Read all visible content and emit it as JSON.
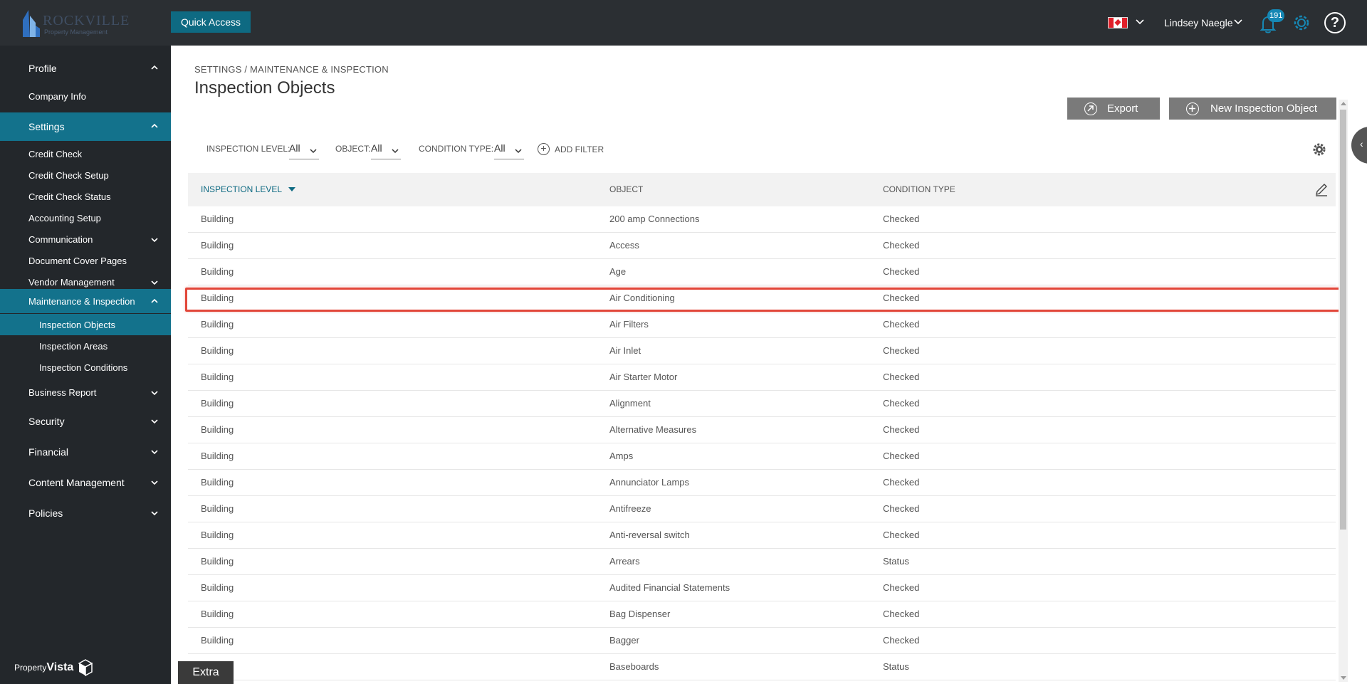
{
  "topbar": {
    "logo_text": "ROCKVILLE",
    "logo_subtitle": "Property Management",
    "quick_access": "Quick Access",
    "user_name": "Lindsey Naegle",
    "notification_count": "191",
    "help_icon": "?"
  },
  "sidebar": {
    "items": [
      {
        "label": "Profile"
      },
      {
        "label": "Company Info"
      },
      {
        "label": "Settings"
      },
      {
        "label": "Credit Check"
      },
      {
        "label": "Credit Check Setup"
      },
      {
        "label": "Credit Check Status"
      },
      {
        "label": "Accounting Setup"
      },
      {
        "label": "Communication"
      },
      {
        "label": "Document Cover Pages"
      },
      {
        "label": "Vendor Management"
      },
      {
        "label": "Maintenance & Inspection"
      },
      {
        "label": "Inspection Objects"
      },
      {
        "label": "Inspection Areas"
      },
      {
        "label": "Inspection Conditions"
      },
      {
        "label": "Business Report"
      },
      {
        "label": "Security"
      },
      {
        "label": "Financial"
      },
      {
        "label": "Content Management"
      },
      {
        "label": "Policies"
      }
    ],
    "footer_brand_1": "Property",
    "footer_brand_2": "Vista"
  },
  "main": {
    "breadcrumb": "SETTINGS / MAINTENANCE & INSPECTION",
    "title": "Inspection Objects",
    "export_label": "Export",
    "new_label": "New Inspection Object",
    "filters": [
      {
        "label": "INSPECTION LEVEL:",
        "value": "All"
      },
      {
        "label": "OBJECT:",
        "value": "All"
      },
      {
        "label": "CONDITION TYPE:",
        "value": "All"
      }
    ],
    "add_filter": "ADD FILTER",
    "columns": [
      "INSPECTION LEVEL",
      "OBJECT",
      "CONDITION TYPE"
    ],
    "rows": [
      [
        "Building",
        "200 amp Connections",
        "Checked"
      ],
      [
        "Building",
        "Access",
        "Checked"
      ],
      [
        "Building",
        "Age",
        "Checked"
      ],
      [
        "Building",
        "Air Conditioning",
        "Checked"
      ],
      [
        "Building",
        "Air Filters",
        "Checked"
      ],
      [
        "Building",
        "Air Inlet",
        "Checked"
      ],
      [
        "Building",
        "Air Starter Motor",
        "Checked"
      ],
      [
        "Building",
        "Alignment",
        "Checked"
      ],
      [
        "Building",
        "Alternative Measures",
        "Checked"
      ],
      [
        "Building",
        "Amps",
        "Checked"
      ],
      [
        "Building",
        "Annunciator Lamps",
        "Checked"
      ],
      [
        "Building",
        "Antifreeze",
        "Checked"
      ],
      [
        "Building",
        "Anti-reversal switch",
        "Checked"
      ],
      [
        "Building",
        "Arrears",
        "Status"
      ],
      [
        "Building",
        "Audited Financial Statements",
        "Checked"
      ],
      [
        "Building",
        "Bag Dispenser",
        "Checked"
      ],
      [
        "Building",
        "Bagger",
        "Checked"
      ],
      [
        "",
        "Baseboards",
        "Status"
      ]
    ],
    "extra_label": "Extra"
  },
  "colors": {
    "topbar_bg": "#2b2f33",
    "sidebar_bg": "#23272b",
    "accent_teal": "#13728c",
    "highlight_red": "#e2473a",
    "button_grey": "#7a7a7a"
  }
}
